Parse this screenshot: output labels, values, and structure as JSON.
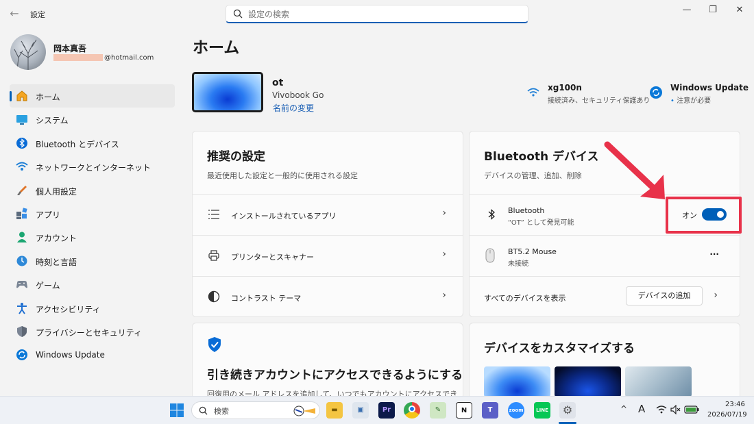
{
  "window": {
    "title": "設定",
    "search_placeholder": "設定の検索",
    "back": "←",
    "minimize": "—",
    "restore": "❐",
    "close": "✕"
  },
  "profile": {
    "name": "岡本真吾",
    "email_suffix": "@hotmail.com"
  },
  "sidebar": {
    "items": [
      {
        "label": "ホーム",
        "icon": "home-icon",
        "active": true
      },
      {
        "label": "システム",
        "icon": "system-icon"
      },
      {
        "label": "Bluetooth とデバイス",
        "icon": "bluetooth-icon"
      },
      {
        "label": "ネットワークとインターネット",
        "icon": "network-icon"
      },
      {
        "label": "個人用設定",
        "icon": "brush-icon"
      },
      {
        "label": "アプリ",
        "icon": "apps-icon"
      },
      {
        "label": "アカウント",
        "icon": "account-icon"
      },
      {
        "label": "時刻と言語",
        "icon": "clock-globe-icon"
      },
      {
        "label": "ゲーム",
        "icon": "gamepad-icon"
      },
      {
        "label": "アクセシビリティ",
        "icon": "accessibility-icon"
      },
      {
        "label": "プライバシーとセキュリティ",
        "icon": "shield-icon"
      },
      {
        "label": "Windows Update",
        "icon": "update-icon"
      }
    ]
  },
  "main": {
    "title": "ホーム",
    "device": {
      "name": "ot",
      "model": "Vivobook Go",
      "rename_link": "名前の変更"
    },
    "status": {
      "wifi": {
        "title": "xg100n",
        "subtitle": "接続済み、セキュリティ保護あり"
      },
      "update": {
        "title": "Windows Update",
        "subtitle": "注意が必要"
      }
    },
    "recommended": {
      "title": "推奨の設定",
      "subtitle": "最近使用した設定と一般的に使用される設定",
      "rows": [
        {
          "label": "インストールされているアプリ",
          "icon": "list-icon"
        },
        {
          "label": "プリンターとスキャナー",
          "icon": "printer-icon"
        },
        {
          "label": "コントラスト テーマ",
          "icon": "contrast-icon"
        }
      ],
      "chevron": "›"
    },
    "bluetooth": {
      "title": "Bluetooth デバイス",
      "subtitle": "デバイスの管理、追加、削除",
      "bt_row": {
        "title": "Bluetooth",
        "subtitle": "“OT” として発見可能",
        "toggle_label": "オン",
        "toggle_on": true
      },
      "mouse_row": {
        "title": "BT5.2 Mouse",
        "subtitle": "未接続",
        "more": "···"
      },
      "footer": {
        "show_all": "すべてのデバイスを表示",
        "add_button": "デバイスの追加",
        "chevron": "›"
      }
    },
    "account_card": {
      "title": "引き続きアカウントにアクセスできるようにする",
      "subtitle": "回復用のメール アドレスを追加して、いつでもアカウントにアクセスできるよう"
    },
    "customize_card": {
      "title": "デバイスをカスタマイズする"
    }
  },
  "taskbar": {
    "search_label": "検索",
    "time": "23:46",
    "date": "2026/07/19",
    "tray_chevron": "^",
    "tray_ime": "A"
  },
  "colors": {
    "accent": "#005fb8",
    "highlight": "#e8324a"
  }
}
